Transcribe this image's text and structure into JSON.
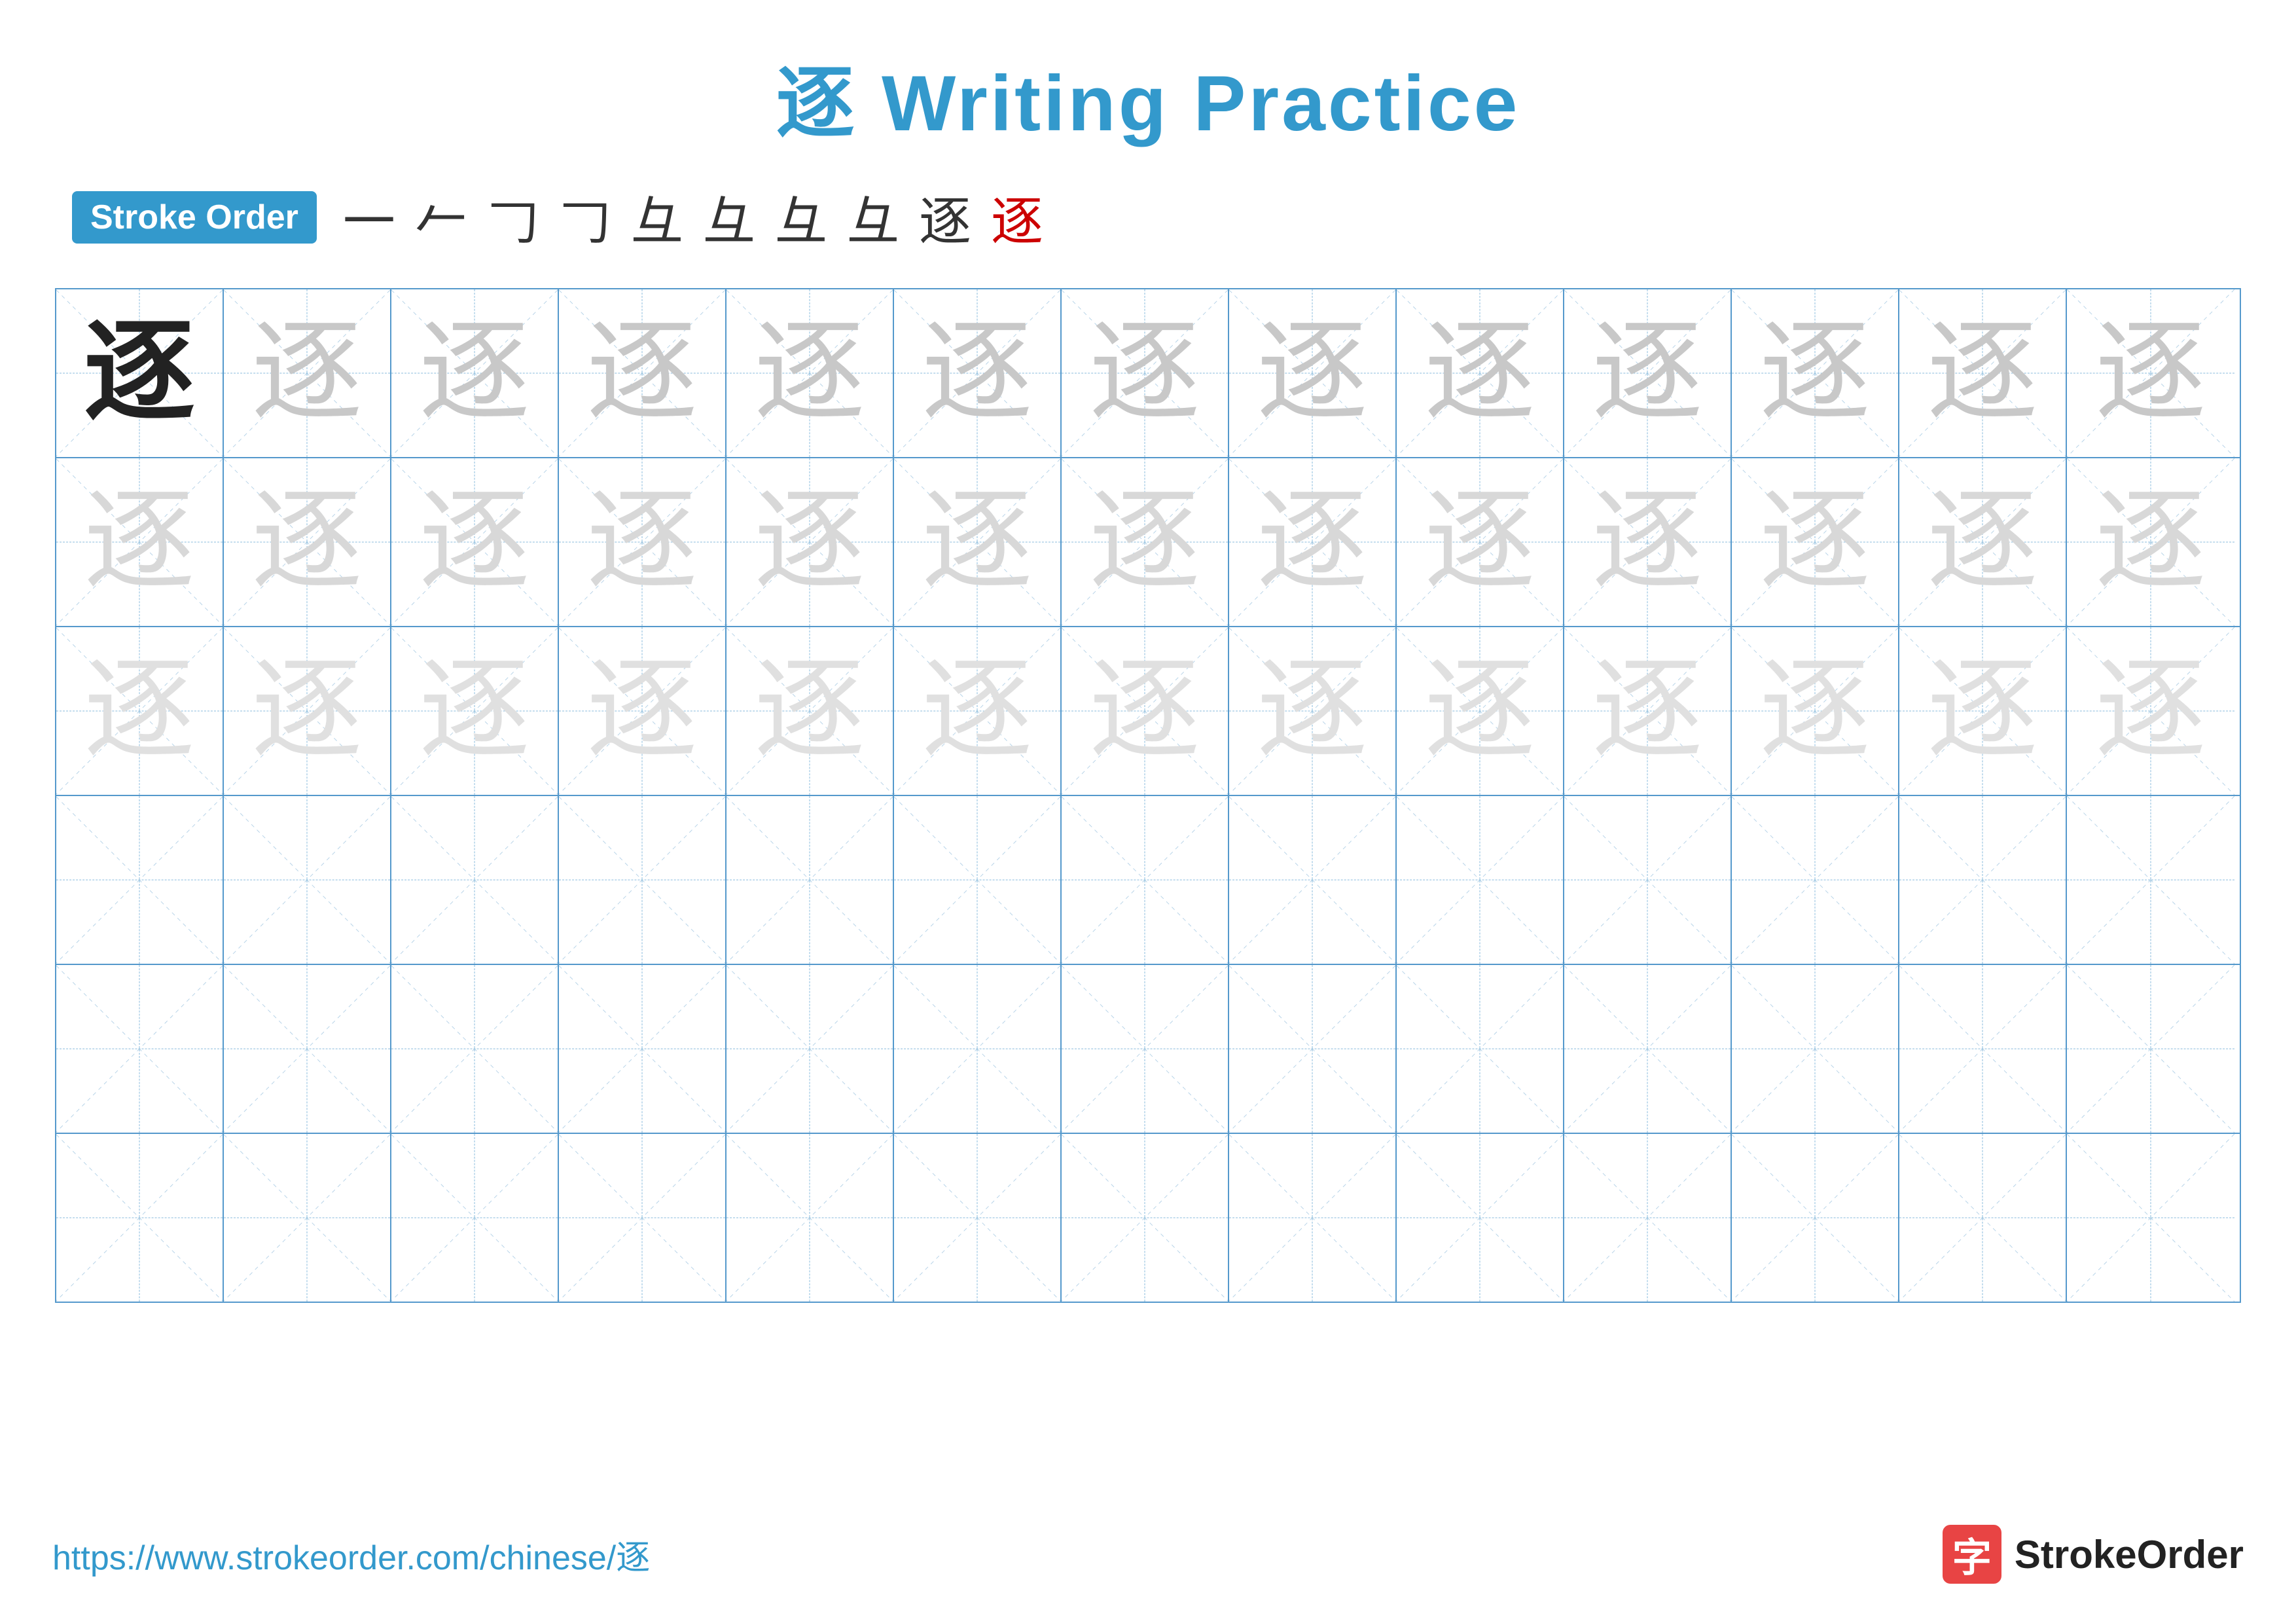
{
  "title": "逐 Writing Practice",
  "strokeOrder": {
    "label": "Stroke Order",
    "strokes": [
      "一",
      "𠂉",
      "𠃌",
      "𠃌",
      "彑",
      "彑",
      "彑",
      "彑",
      "逐",
      "逐"
    ]
  },
  "character": "逐",
  "rows": [
    {
      "type": "practice",
      "cells": [
        "solid",
        "light1",
        "light1",
        "light1",
        "light1",
        "light1",
        "light1",
        "light1",
        "light1",
        "light1",
        "light1",
        "light1",
        "light1"
      ]
    },
    {
      "type": "practice",
      "cells": [
        "light2",
        "light2",
        "light2",
        "light2",
        "light2",
        "light2",
        "light2",
        "light2",
        "light2",
        "light2",
        "light2",
        "light2",
        "light2"
      ]
    },
    {
      "type": "practice",
      "cells": [
        "light3",
        "light3",
        "light3",
        "light3",
        "light3",
        "light3",
        "light3",
        "light3",
        "light3",
        "light3",
        "light3",
        "light3",
        "light3"
      ]
    },
    {
      "type": "empty"
    },
    {
      "type": "empty"
    },
    {
      "type": "empty"
    }
  ],
  "footer": {
    "url": "https://www.strokeorder.com/chinese/逐",
    "logoChar": "字",
    "logoText": "StrokeOrder"
  }
}
